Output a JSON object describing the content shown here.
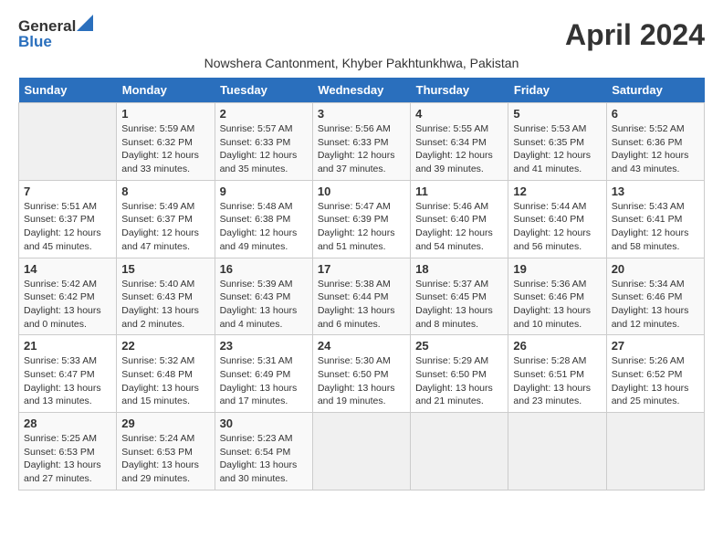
{
  "header": {
    "logo_line1": "General",
    "logo_line2": "Blue",
    "month_year": "April 2024",
    "subtitle": "Nowshera Cantonment, Khyber Pakhtunkhwa, Pakistan"
  },
  "days_of_week": [
    "Sunday",
    "Monday",
    "Tuesday",
    "Wednesday",
    "Thursday",
    "Friday",
    "Saturday"
  ],
  "weeks": [
    [
      {
        "day": "",
        "info": ""
      },
      {
        "day": "1",
        "info": "Sunrise: 5:59 AM\nSunset: 6:32 PM\nDaylight: 12 hours\nand 33 minutes."
      },
      {
        "day": "2",
        "info": "Sunrise: 5:57 AM\nSunset: 6:33 PM\nDaylight: 12 hours\nand 35 minutes."
      },
      {
        "day": "3",
        "info": "Sunrise: 5:56 AM\nSunset: 6:33 PM\nDaylight: 12 hours\nand 37 minutes."
      },
      {
        "day": "4",
        "info": "Sunrise: 5:55 AM\nSunset: 6:34 PM\nDaylight: 12 hours\nand 39 minutes."
      },
      {
        "day": "5",
        "info": "Sunrise: 5:53 AM\nSunset: 6:35 PM\nDaylight: 12 hours\nand 41 minutes."
      },
      {
        "day": "6",
        "info": "Sunrise: 5:52 AM\nSunset: 6:36 PM\nDaylight: 12 hours\nand 43 minutes."
      }
    ],
    [
      {
        "day": "7",
        "info": "Sunrise: 5:51 AM\nSunset: 6:37 PM\nDaylight: 12 hours\nand 45 minutes."
      },
      {
        "day": "8",
        "info": "Sunrise: 5:49 AM\nSunset: 6:37 PM\nDaylight: 12 hours\nand 47 minutes."
      },
      {
        "day": "9",
        "info": "Sunrise: 5:48 AM\nSunset: 6:38 PM\nDaylight: 12 hours\nand 49 minutes."
      },
      {
        "day": "10",
        "info": "Sunrise: 5:47 AM\nSunset: 6:39 PM\nDaylight: 12 hours\nand 51 minutes."
      },
      {
        "day": "11",
        "info": "Sunrise: 5:46 AM\nSunset: 6:40 PM\nDaylight: 12 hours\nand 54 minutes."
      },
      {
        "day": "12",
        "info": "Sunrise: 5:44 AM\nSunset: 6:40 PM\nDaylight: 12 hours\nand 56 minutes."
      },
      {
        "day": "13",
        "info": "Sunrise: 5:43 AM\nSunset: 6:41 PM\nDaylight: 12 hours\nand 58 minutes."
      }
    ],
    [
      {
        "day": "14",
        "info": "Sunrise: 5:42 AM\nSunset: 6:42 PM\nDaylight: 13 hours\nand 0 minutes."
      },
      {
        "day": "15",
        "info": "Sunrise: 5:40 AM\nSunset: 6:43 PM\nDaylight: 13 hours\nand 2 minutes."
      },
      {
        "day": "16",
        "info": "Sunrise: 5:39 AM\nSunset: 6:43 PM\nDaylight: 13 hours\nand 4 minutes."
      },
      {
        "day": "17",
        "info": "Sunrise: 5:38 AM\nSunset: 6:44 PM\nDaylight: 13 hours\nand 6 minutes."
      },
      {
        "day": "18",
        "info": "Sunrise: 5:37 AM\nSunset: 6:45 PM\nDaylight: 13 hours\nand 8 minutes."
      },
      {
        "day": "19",
        "info": "Sunrise: 5:36 AM\nSunset: 6:46 PM\nDaylight: 13 hours\nand 10 minutes."
      },
      {
        "day": "20",
        "info": "Sunrise: 5:34 AM\nSunset: 6:46 PM\nDaylight: 13 hours\nand 12 minutes."
      }
    ],
    [
      {
        "day": "21",
        "info": "Sunrise: 5:33 AM\nSunset: 6:47 PM\nDaylight: 13 hours\nand 13 minutes."
      },
      {
        "day": "22",
        "info": "Sunrise: 5:32 AM\nSunset: 6:48 PM\nDaylight: 13 hours\nand 15 minutes."
      },
      {
        "day": "23",
        "info": "Sunrise: 5:31 AM\nSunset: 6:49 PM\nDaylight: 13 hours\nand 17 minutes."
      },
      {
        "day": "24",
        "info": "Sunrise: 5:30 AM\nSunset: 6:50 PM\nDaylight: 13 hours\nand 19 minutes."
      },
      {
        "day": "25",
        "info": "Sunrise: 5:29 AM\nSunset: 6:50 PM\nDaylight: 13 hours\nand 21 minutes."
      },
      {
        "day": "26",
        "info": "Sunrise: 5:28 AM\nSunset: 6:51 PM\nDaylight: 13 hours\nand 23 minutes."
      },
      {
        "day": "27",
        "info": "Sunrise: 5:26 AM\nSunset: 6:52 PM\nDaylight: 13 hours\nand 25 minutes."
      }
    ],
    [
      {
        "day": "28",
        "info": "Sunrise: 5:25 AM\nSunset: 6:53 PM\nDaylight: 13 hours\nand 27 minutes."
      },
      {
        "day": "29",
        "info": "Sunrise: 5:24 AM\nSunset: 6:53 PM\nDaylight: 13 hours\nand 29 minutes."
      },
      {
        "day": "30",
        "info": "Sunrise: 5:23 AM\nSunset: 6:54 PM\nDaylight: 13 hours\nand 30 minutes."
      },
      {
        "day": "",
        "info": ""
      },
      {
        "day": "",
        "info": ""
      },
      {
        "day": "",
        "info": ""
      },
      {
        "day": "",
        "info": ""
      }
    ]
  ]
}
